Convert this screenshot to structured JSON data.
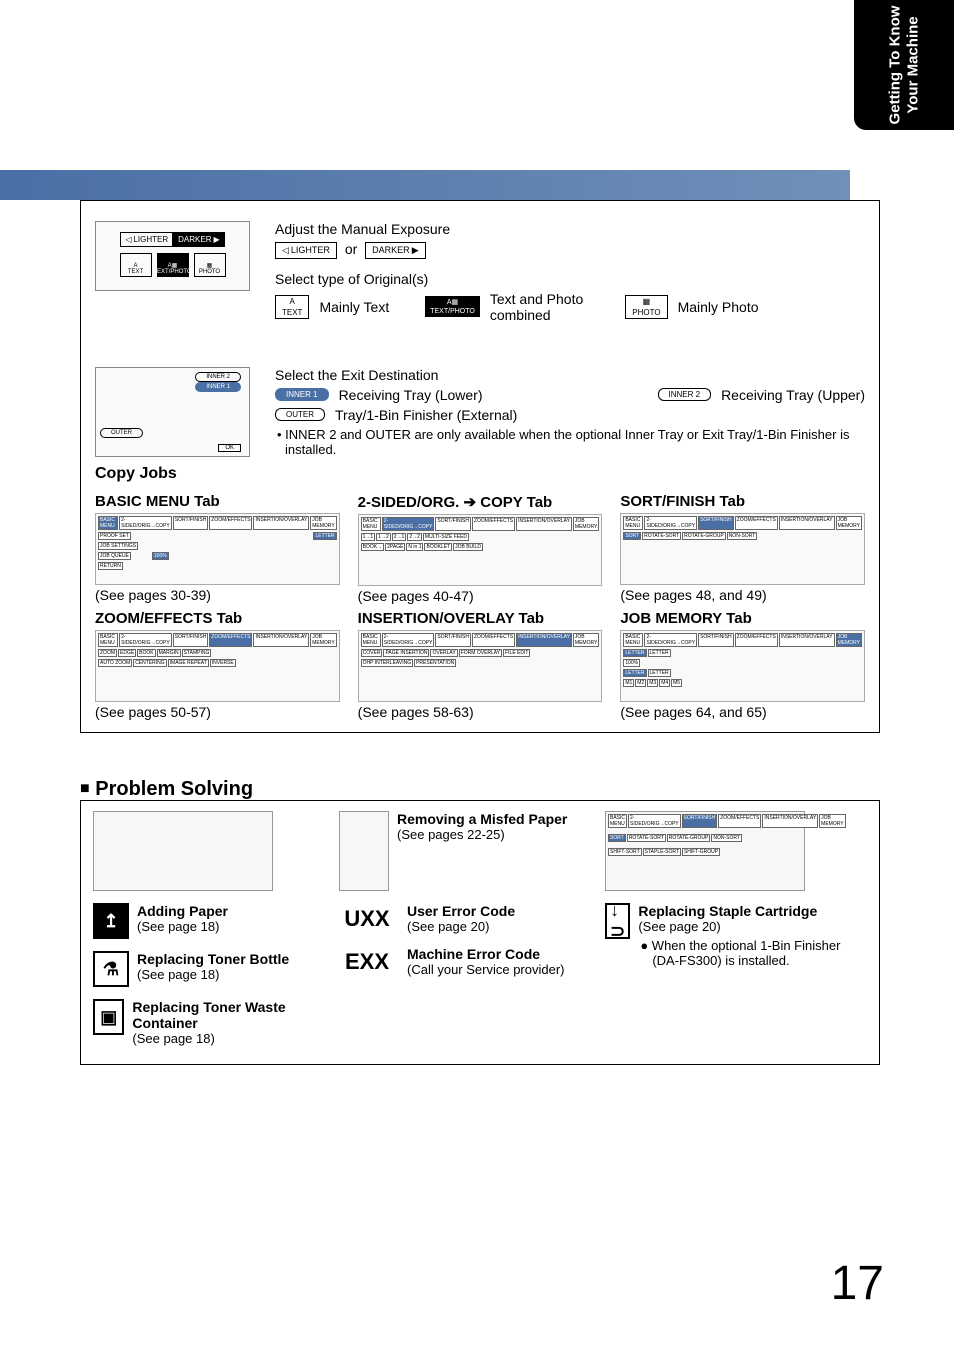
{
  "sideTab": {
    "line1": "Getting To Know",
    "line2": "Your Machine"
  },
  "exposure": {
    "title": "Adjust the Manual Exposure",
    "lighter": "LIGHTER",
    "darker": "DARKER",
    "or": "or"
  },
  "original": {
    "title": "Select type of Original(s)",
    "textBtn": "TEXT",
    "textPhotoBtn": "TEXT/PHOTO",
    "photoBtn": "PHOTO",
    "textLabel": "Mainly Text",
    "comboLabel1": "Text and Photo",
    "comboLabel2": "combined",
    "photoLabel": "Mainly Photo"
  },
  "exit": {
    "title": "Select the Exit Destination",
    "inner1Btn": "INNER 1",
    "inner1Label": "Receiving Tray (Lower)",
    "inner2Btn": "INNER 2",
    "inner2Label": "Receiving Tray (Upper)",
    "outerBtn": "OUTER",
    "outerLabel": "Tray/1-Bin Finisher (External)",
    "note": "• INNER 2 and OUTER are only available when the optional Inner Tray or Exit Tray/1-Bin Finisher is installed."
  },
  "copyJobs": "Copy Jobs",
  "tabs": {
    "basic": {
      "title": "BASIC MENU Tab",
      "ref": "(See pages 30-39)"
    },
    "twoSided": {
      "title": "2-SIDED/ORG. ➔ COPY Tab",
      "ref": "(See pages 40-47)"
    },
    "sort": {
      "title": "SORT/FINISH Tab",
      "ref": "(See pages 48, and 49)"
    },
    "zoom": {
      "title": "ZOOM/EFFECTS Tab",
      "ref": "(See pages 50-57)"
    },
    "insert": {
      "title": "INSERTION/OVERLAY Tab",
      "ref": "(See pages 58-63)"
    },
    "jobmem": {
      "title": "JOB MEMORY Tab",
      "ref": "(See pages 64, and 65)"
    }
  },
  "problemSolving": {
    "header": "Problem Solving",
    "addPaper": {
      "title": "Adding Paper",
      "ref": "(See page 18)"
    },
    "toner": {
      "title": "Replacing Toner Bottle",
      "ref": "(See page 18)"
    },
    "waste": {
      "title": "Replacing Toner Waste Container",
      "ref": "(See page 18)"
    },
    "misfed": {
      "title": "Removing a Misfed Paper",
      "ref": "(See pages 22-25)"
    },
    "uxx": {
      "code": "UXX",
      "title": "User Error Code",
      "ref": "(See page 20)"
    },
    "exx": {
      "code": "EXX",
      "title": "Machine Error Code",
      "ref": "(Call your Service provider)"
    },
    "staple": {
      "title": "Replacing Staple Cartridge",
      "ref": "(See page 20)",
      "note": "● When the optional 1-Bin Finisher (DA-FS300) is installed."
    }
  },
  "pageNumber": "17",
  "miniLabels": {
    "basicMenu": "BASIC MENU",
    "twoSided": "2-SIDED/ORIG→COPY",
    "sortFinish": "SORT/FINISH",
    "zoomEffects": "ZOOM/EFFECTS",
    "insertionOverlay": "INSERTION/OVERLAY",
    "jobMemory": "JOB MEMORY",
    "inner1": "INNER 1",
    "inner2": "INNER 2",
    "outer": "OUTER",
    "ok": "OK",
    "proofSet": "PROOF SET",
    "letter": "LETTER",
    "jobSettings": "JOB SETTINGS",
    "jobQueue": "JOB QUEUE",
    "return": "RETURN",
    "hundred": "100%",
    "sort": "SORT",
    "rotateSort": "ROTATE-SORT",
    "rotateGroup": "ROTATE-GROUP",
    "nonSort": "NON-SORT",
    "shiftSort": "SHIFT-SORT",
    "stapleLeft": "STAPLE-SORT",
    "shiftGroup": "SHIFT-GROUP",
    "zoom": "ZOOM",
    "edge": "EDGE",
    "book": "BOOK",
    "margin": "MARGIN",
    "stamping": "STAMPING",
    "autoZoom": "AUTO ZOOM",
    "centering": "CENTERING",
    "imageRepeat": "IMAGE REPEAT",
    "inverse": "INVERSE",
    "cover": "COVER",
    "pageInsertion": "PAGE INSERTION",
    "overlay": "OVERLAY",
    "formOverlay": "FORM OVERLAY",
    "fileEdit": "FILE EDIT",
    "ohp": "OHP INTERLEAVING",
    "presentation": "PRESENTATION",
    "multiSize": "MULTI-SIZE FEED",
    "nIn1": "N in 1",
    "booklet": "BOOKLET",
    "bookArr": "BOOK→",
    "twoPage": "2PAGE",
    "jobBuild": "JOB BUILD",
    "m1": "M1",
    "m2": "M2",
    "m3": "M3",
    "m4": "M4",
    "m5": "M5"
  }
}
